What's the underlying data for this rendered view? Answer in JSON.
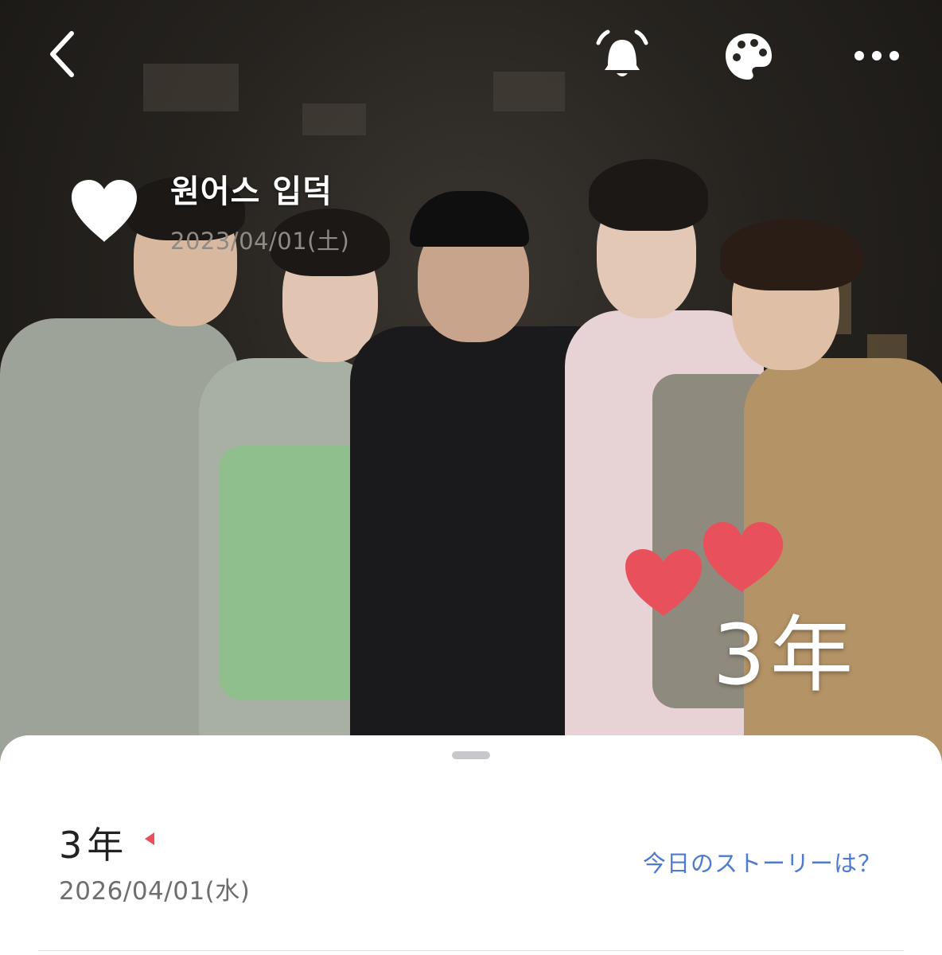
{
  "topbar": {
    "back_icon": "chevron-left-icon",
    "bell_icon": "bell-icon",
    "theme_icon": "palette-icon",
    "more_icon": "more-horizontal-icon"
  },
  "event": {
    "icon": "heart-icon",
    "title": "원어스 입덕",
    "date": "2023/04/01(土)"
  },
  "photo_stamp": {
    "icon": "two-hearts-icon",
    "text": "3年"
  },
  "sheet": {
    "years_label": "3年",
    "years_icon": "small-heart-icon",
    "years_date": "2026/04/01(水)",
    "story_link": "今日のストーリーは？"
  },
  "colors": {
    "heart_red": "#e8515c",
    "link_blue": "#4e7ad0",
    "white": "#ffffff"
  }
}
